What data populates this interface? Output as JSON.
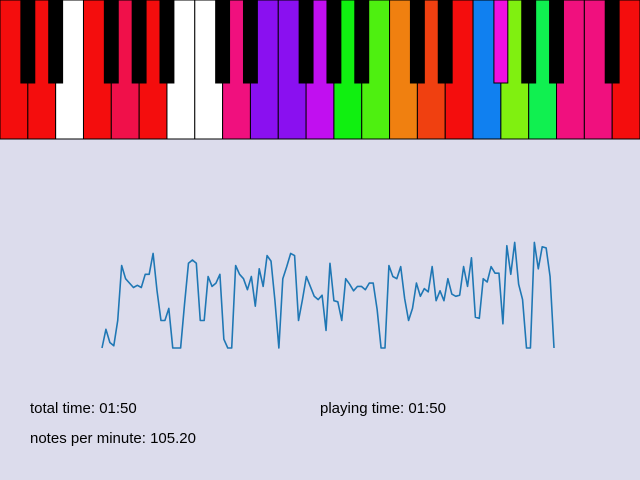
{
  "keyboard": {
    "white_keys": [
      "#f40d0d",
      "#f40d0d",
      "#ffffff",
      "#f40d0d",
      "#f0104a",
      "#f40d0d",
      "#ffffff",
      "#ffffff",
      "#f0107e",
      "#8a10f0",
      "#8a10f0",
      "#c10ff0",
      "#10f010",
      "#4ef010",
      "#f08010",
      "#f04010",
      "#f40d0d",
      "#1080f0",
      "#80f010",
      "#10f050",
      "#f0107e",
      "#f0107e",
      "#f40d0d"
    ],
    "black_keys": [
      {
        "after_white": 0,
        "color": "#000000"
      },
      {
        "after_white": 1,
        "color": "#000000"
      },
      {
        "after_white": 3,
        "color": "#000000"
      },
      {
        "after_white": 4,
        "color": "#000000"
      },
      {
        "after_white": 5,
        "color": "#000000"
      },
      {
        "after_white": 7,
        "color": "#000000"
      },
      {
        "after_white": 8,
        "color": "#000000"
      },
      {
        "after_white": 10,
        "color": "#000000"
      },
      {
        "after_white": 11,
        "color": "#000000"
      },
      {
        "after_white": 12,
        "color": "#000000"
      },
      {
        "after_white": 14,
        "color": "#000000"
      },
      {
        "after_white": 15,
        "color": "#000000"
      },
      {
        "after_white": 17,
        "color": "#f010e0"
      },
      {
        "after_white": 18,
        "color": "#000000"
      },
      {
        "after_white": 19,
        "color": "#000000"
      },
      {
        "after_white": 21,
        "color": "#000000"
      }
    ]
  },
  "stats": {
    "total_time_label": "total time: 01:50",
    "playing_time_label": "playing time: 01:50",
    "notes_per_minute_label": "notes per minute: 105.20"
  },
  "chart_data": {
    "type": "line",
    "title": "",
    "xlabel": "",
    "ylabel": "",
    "color": "#1f77b4",
    "ylim": [
      0,
      1
    ],
    "values": [
      0.0,
      0.17,
      0.05,
      0.02,
      0.25,
      0.75,
      0.63,
      0.59,
      0.55,
      0.57,
      0.55,
      0.67,
      0.67,
      0.86,
      0.52,
      0.25,
      0.25,
      0.36,
      0.0,
      0.0,
      0.0,
      0.4,
      0.77,
      0.8,
      0.77,
      0.25,
      0.25,
      0.65,
      0.56,
      0.59,
      0.67,
      0.08,
      0.0,
      0.0,
      0.75,
      0.67,
      0.63,
      0.53,
      0.65,
      0.38,
      0.72,
      0.56,
      0.84,
      0.79,
      0.43,
      0.0,
      0.63,
      0.74,
      0.86,
      0.84,
      0.25,
      0.44,
      0.65,
      0.56,
      0.47,
      0.44,
      0.48,
      0.16,
      0.77,
      0.43,
      0.42,
      0.25,
      0.63,
      0.58,
      0.52,
      0.56,
      0.56,
      0.53,
      0.59,
      0.59,
      0.35,
      0.0,
      0.0,
      0.75,
      0.65,
      0.63,
      0.74,
      0.45,
      0.25,
      0.36,
      0.59,
      0.47,
      0.54,
      0.51,
      0.74,
      0.43,
      0.52,
      0.43,
      0.63,
      0.49,
      0.47,
      0.48,
      0.74,
      0.56,
      0.82,
      0.28,
      0.27,
      0.63,
      0.6,
      0.74,
      0.68,
      0.68,
      0.22,
      0.93,
      0.67,
      0.96,
      0.58,
      0.44,
      0.0,
      0.0,
      0.96,
      0.72,
      0.92,
      0.91,
      0.65,
      0.0
    ]
  }
}
